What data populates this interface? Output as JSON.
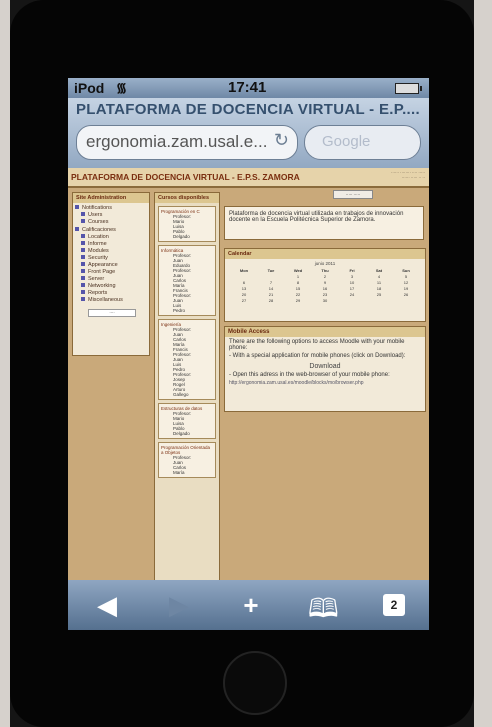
{
  "status_bar": {
    "carrier": "iPod",
    "time": "17:41"
  },
  "browser": {
    "page_title": "PLATAFORMA DE DOCENCIA VIRTUAL - E.P....",
    "url": "ergonomia.zam.usal.e...",
    "search_placeholder": "Google",
    "toolbar": {
      "pages_count": "2"
    }
  },
  "site": {
    "title": "PLATAFORMA DE DOCENCIA VIRTUAL - E.P.S. ZAMORA",
    "admin": {
      "heading": "Site Administration",
      "sections": [
        {
          "label": "Notifications",
          "items": [
            "Users",
            "Courses"
          ]
        },
        {
          "label": "Calificaciones",
          "items": [
            "Location",
            "Informe",
            "Modules",
            "Security",
            "Appearance",
            "Front Page",
            "Server",
            "Networking",
            "Reports",
            "Miscellaneous"
          ]
        }
      ]
    },
    "courses": {
      "heading": "Cursos disponibles",
      "items": [
        {
          "title": "Programación en C",
          "names": [
            "Profesor:",
            "Mario",
            "Luisa",
            "Pablo",
            "Delgado"
          ]
        },
        {
          "title": "Informática",
          "names": [
            "Profesor:",
            "Juan",
            "Eduardo",
            "Profesor:",
            "Juan",
            "Carlos",
            "María",
            "Francis",
            "Profesor:",
            "Juan",
            "Luis",
            "Pedro"
          ]
        },
        {
          "title": "Ingeniería",
          "names": [
            "Profesor:",
            "Juan",
            "Carlos",
            "María",
            "Francis",
            "Profesor:",
            "Juan",
            "Luis",
            "Pedro",
            "Profesor:",
            "Josep",
            "Rogel",
            "Arturo",
            "Gallego"
          ]
        },
        {
          "title": "Estructuras de datos",
          "names": [
            "Profesor:",
            "Mario",
            "Luisa",
            "Pablo",
            "Delgado"
          ]
        },
        {
          "title": "Programación Orientada a Objetos",
          "names": [
            "Profesor:",
            "Juan",
            "Carlos",
            "María"
          ]
        }
      ]
    },
    "intro_text": "Plataforma de docencia virtual utilizada en trabajos de innovación docente en la Escuela Politécnica Superior de Zamora.",
    "calendar": {
      "heading": "Calendar",
      "month": "junio 2011",
      "day_names": [
        "Mon",
        "Tue",
        "Wed",
        "Thu",
        "Fri",
        "Sat",
        "Sun"
      ],
      "days": [
        "",
        "",
        "1",
        "2",
        "3",
        "4",
        "5",
        "6",
        "7",
        "8",
        "9",
        "10",
        "11",
        "12",
        "13",
        "14",
        "15",
        "16",
        "17",
        "18",
        "19",
        "20",
        "21",
        "22",
        "23",
        "24",
        "25",
        "26",
        "27",
        "28",
        "29",
        "30",
        "",
        "",
        ""
      ]
    },
    "mobile": {
      "heading": "Mobile Access",
      "text1": "There are the following options to access Moodle with your mobile phone:",
      "text2": "- With a special application for mobile phones (click on Download):",
      "download": "Download",
      "text3": "- Open this adress in the web-browser of your mobile phone:",
      "url": "http://ergonomia.zam.usal.es/moodle/blocks/mo/browser.php"
    }
  }
}
